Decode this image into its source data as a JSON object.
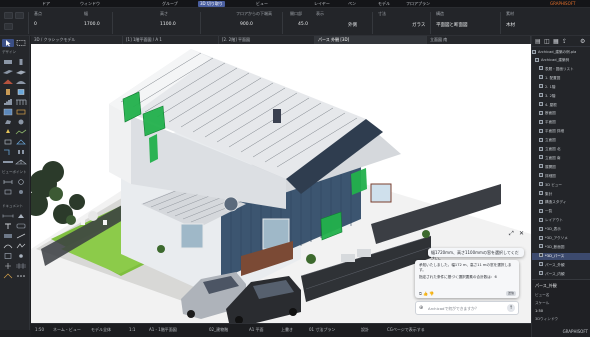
{
  "topbar": {
    "items": [
      "ドア",
      "ウィンドウ",
      "グループ",
      "3D 切り取り",
      "ビュー",
      "レイヤー",
      "ペン",
      "モデル",
      "フロアプラン",
      "GRAPHISOFT"
    ],
    "active_index": 3
  },
  "infobox": {
    "fields": [
      {
        "label": "基点",
        "value": "0"
      },
      {
        "label": "幅",
        "value": "1700.0"
      },
      {
        "label": "高さ",
        "value": "1100.0"
      },
      {
        "label": "フロアからの下端高",
        "value": "900.0"
      },
      {
        "label": "開口部",
        "value": "45.0"
      },
      {
        "label": "表示",
        "value": "外側"
      },
      {
        "label": "寸法",
        "value": "すべて"
      },
      {
        "label": "サーフェス",
        "value": "ガラス"
      },
      {
        "label": "構造",
        "value": "平面図と断面図"
      },
      {
        "label": "素材",
        "value": "木材"
      }
    ]
  },
  "tabs": [
    {
      "label": "3D / クラシックモデル"
    },
    {
      "label": "[1] 1階平面図 / A 1"
    },
    {
      "label": "[2. 2階] 平面図"
    },
    {
      "label": "パース 外観 [3D]"
    },
    {
      "label": "立面図 南"
    }
  ],
  "active_tab": 3,
  "toolbox": {
    "groups": [
      "デザイン",
      "ビューポイント",
      "ドキュメント"
    ]
  },
  "navigator": {
    "title": "Archicad_建築の例.pla",
    "items": [
      {
        "label": "Archicad_建築例"
      },
      {
        "label": "表題・図面リスト"
      },
      {
        "label": "1. 配置図"
      },
      {
        "label": "2. 1階"
      },
      {
        "label": "3. 2階"
      },
      {
        "label": "4. 屋根"
      },
      {
        "label": "断面図"
      },
      {
        "label": "平面図"
      },
      {
        "label": "平面図 詳細"
      },
      {
        "label": "立面図"
      },
      {
        "label": "立面図 北"
      },
      {
        "label": "立面図 南"
      },
      {
        "label": "展開図"
      },
      {
        "label": "詳細図"
      },
      {
        "label": "3D ビュー"
      },
      {
        "label": "集計"
      },
      {
        "label": "構造スタディ"
      },
      {
        "label": "一覧"
      },
      {
        "label": "レイアウト"
      },
      {
        "label": "*3D_表示"
      },
      {
        "label": "*3D_アクソメ"
      },
      {
        "label": "*3D_断面図"
      },
      {
        "label": "*3D_パース"
      },
      {
        "label": "パース_外観"
      },
      {
        "label": "パース_内観"
      }
    ],
    "selected_index": 22,
    "bottom": {
      "title": "パース_外観",
      "rows": [
        "ビュー名",
        "スケール",
        "1:50",
        "3Dウィンドウ"
      ]
    }
  },
  "statusbar": {
    "items": [
      "1:50",
      "ネーム・ビュー",
      "モデル全体",
      "1:1",
      "A1 - 1階平面図",
      "02_建物階",
      "A1 平面",
      "上書き",
      "01 寸法プラン",
      "設計",
      "CGページで表示する"
    ]
  },
  "ai": {
    "prompt": "幅1720mm、高さ1100mmの窓を選択してください。",
    "reply_line1": "承知いたしました。幅172 m、高さ11 mの窓を選択します。",
    "reply_line2": "指定された条件に基づく選択要素の合計数は：6",
    "input_placeholder": "Archicadで何ができますか？",
    "send_label": "送信"
  },
  "colors": {
    "accent": "#4a5fa0",
    "selection": "#3c4a6e",
    "highlight_green": "#22b14c"
  }
}
